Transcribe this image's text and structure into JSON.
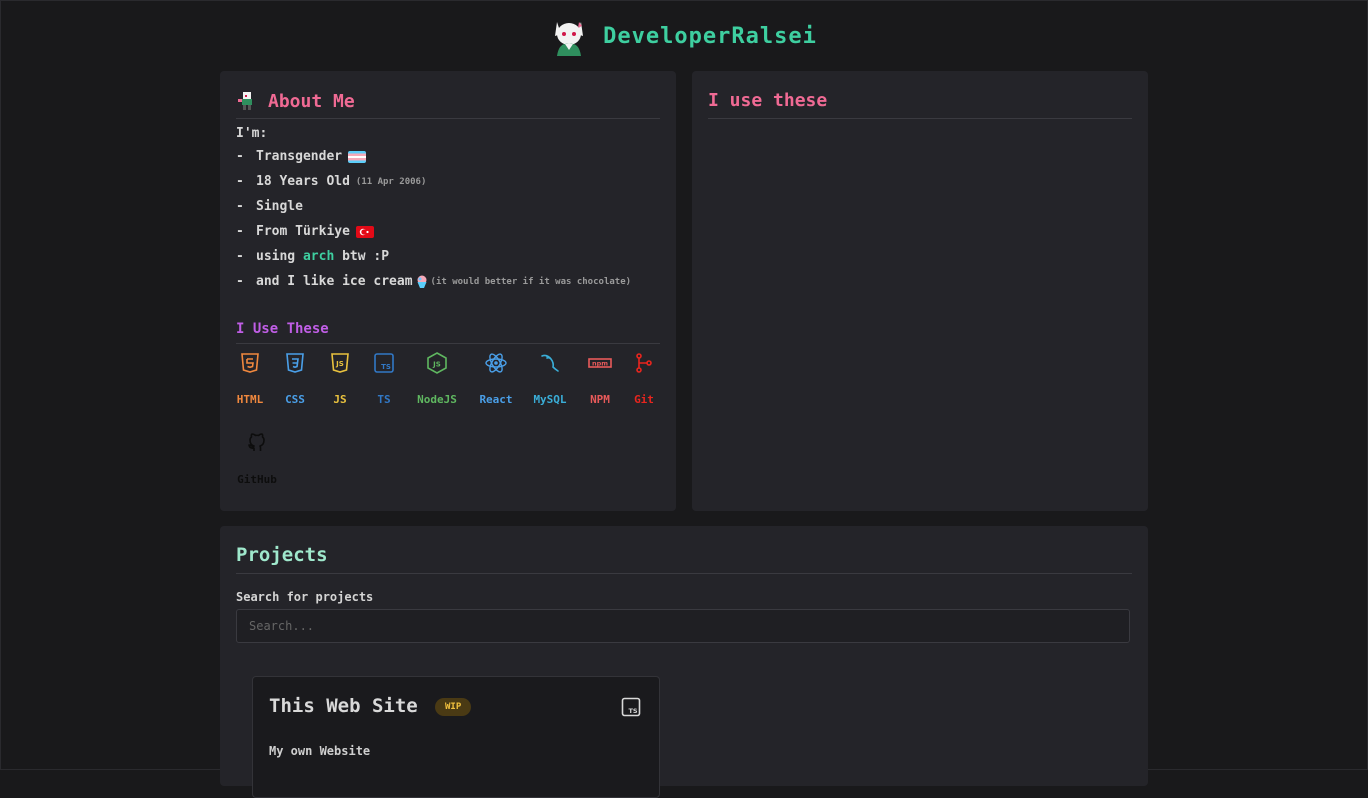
{
  "header": {
    "title": "DeveloperRalsei"
  },
  "about": {
    "title": "About Me",
    "intro": "I'm:",
    "dash": "-",
    "items": [
      {
        "text": "Transgender",
        "note": ""
      },
      {
        "text": "18 Years Old",
        "note": "(11 Apr 2006)"
      },
      {
        "text": "Single",
        "note": ""
      },
      {
        "text": "From Türkiye",
        "note": ""
      },
      {
        "text_before": "using",
        "highlight": "arch",
        "text_after": "btw :P"
      },
      {
        "text": "and I like ice cream",
        "note": "(it would better if it was chocolate)"
      }
    ],
    "tools_title": "I Use These",
    "tools": [
      {
        "label": "HTML",
        "icon": "html5-icon",
        "color": "#f0883e"
      },
      {
        "label": "CSS",
        "icon": "css3-icon",
        "color": "#4a9fe8"
      },
      {
        "label": "JS",
        "icon": "javascript-icon",
        "color": "#e8c13e"
      },
      {
        "label": "TS",
        "icon": "typescript-icon",
        "color": "#3178c6"
      },
      {
        "label": "NodeJS",
        "icon": "nodejs-icon",
        "color": "#5fb760"
      },
      {
        "label": "React",
        "icon": "react-icon",
        "color": "#4a9fe8"
      },
      {
        "label": "MySQL",
        "icon": "mysql-icon",
        "color": "#3aaed8"
      },
      {
        "label": "NPM",
        "icon": "npm-icon",
        "color": "#e85a5a"
      },
      {
        "label": "Git",
        "icon": "git-icon",
        "color": "#e8251e"
      },
      {
        "label": "GitHub",
        "icon": "github-icon",
        "color": "#0d0d0d"
      }
    ]
  },
  "use_panel": {
    "title": "I use these"
  },
  "projects": {
    "title": "Projects",
    "search_label": "Search for projects",
    "search_placeholder": "Search...",
    "cards": [
      {
        "title": "This Web Site",
        "badge": "WIP",
        "description": "My own Website",
        "icon": "typescript-icon"
      }
    ]
  }
}
